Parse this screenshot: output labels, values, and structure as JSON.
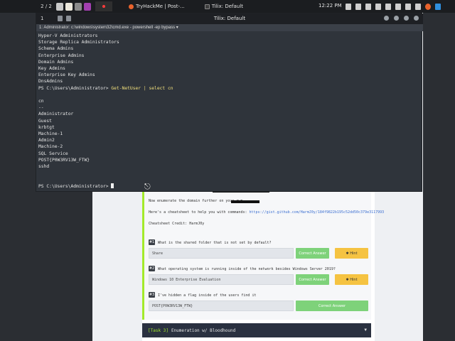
{
  "panel": {
    "workspace": "2 / 2",
    "tasks": [
      {
        "label": "TryHackMe | Post-...",
        "icon": "firefox-icon"
      },
      {
        "label": "Tilix: Default",
        "icon": "terminal-icon"
      }
    ],
    "clock": "12:22 PM"
  },
  "terminal": {
    "tab_number": "1",
    "window_title": "Tilix: Default",
    "session_title": "1: Administrator: c:\\windows\\system32\\cmd.exe - powershell -ep bypass ▾",
    "lines_before": [
      "Hyper-V Administrators",
      "Storage Replica Administrators",
      "Schema Admins",
      "Enterprise Admins",
      "Domain Admins",
      "Key Admins",
      "Enterprise Key Admins",
      "DnsAdmins"
    ],
    "prompt": "PS C:\\Users\\Administrator>",
    "command": "Get-NetUser | select cn",
    "header": "cn",
    "separator": "--",
    "users": [
      "Administrator",
      "Guest",
      "krbtgt",
      "Machine-1",
      "Admin2",
      "Machine-2",
      "SQL Service",
      "POST{P0W3RV13W_FTW}",
      "sshd"
    ]
  },
  "page": {
    "enumerate_text": "Now enumerate the domain further on your own",
    "cheatsheet_text": "Here's a cheatsheet to help you with commands:",
    "cheatsheet_link": "https://gist.github.com/HarmJ0y/184f9822b195c52dd50c379e3117993",
    "credit": "Cheatsheet Credit: HarmJ0y",
    "questions": [
      {
        "num": "#1",
        "text": "What is the shared folder that is not set by default?",
        "answer": "Share",
        "correct_label": "Correct Answer",
        "hint_label": "Hint"
      },
      {
        "num": "#2",
        "text": "What operating system is running inside of the network besides Windows Server 2019?",
        "answer": "Windows 10 Enterprise Evaluation",
        "correct_label": "Correct Answer",
        "hint_label": "Hint"
      },
      {
        "num": "#3",
        "text": "I've hidden a flag inside of the users find it",
        "answer": "POST{P0W3RV13W_FTW}",
        "correct_label": "Correct Answer"
      }
    ],
    "next_task_tag": "Task 3",
    "next_task_title": "Enumeration w/ Bloodhound"
  }
}
